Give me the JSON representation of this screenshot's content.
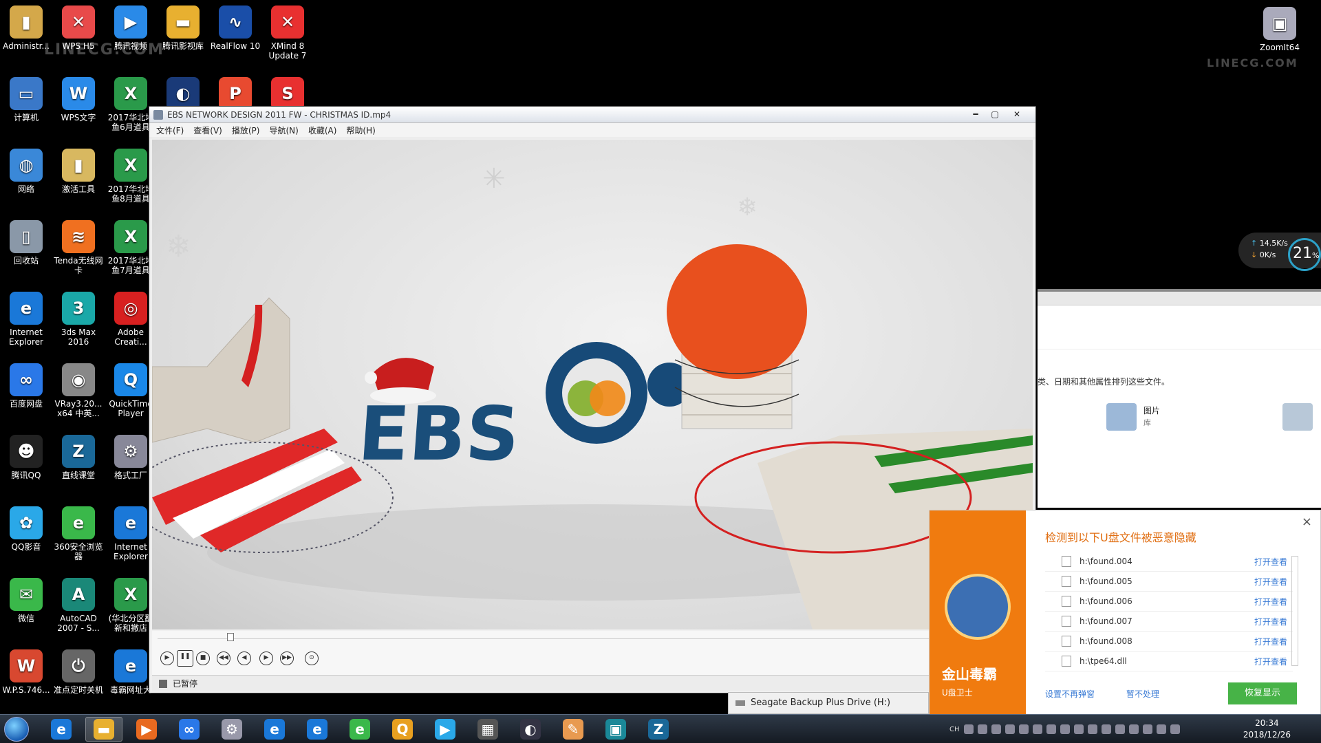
{
  "desktop": {
    "icons": [
      {
        "label": "Administr...",
        "col": 0,
        "row": 0,
        "color": "#d4a84a",
        "glyph": "▮"
      },
      {
        "label": "WPS H5",
        "col": 1,
        "row": 0,
        "color": "#e84a4a",
        "glyph": "✕"
      },
      {
        "label": "腾讯视频",
        "col": 2,
        "row": 0,
        "color": "#2a8ae8",
        "glyph": "▶"
      },
      {
        "label": "腾讯影视库",
        "col": 3,
        "row": 0,
        "color": "#e8b030",
        "glyph": "▬"
      },
      {
        "label": "RealFlow 10",
        "col": 4,
        "row": 0,
        "color": "#1a4ea8",
        "glyph": "∿"
      },
      {
        "label": "XMind 8 Update 7",
        "col": 5,
        "row": 0,
        "color": "#e83030",
        "glyph": "✕"
      },
      {
        "label": "计算机",
        "col": 0,
        "row": 1,
        "color": "#3a78c8",
        "glyph": "▭"
      },
      {
        "label": "WPS文字",
        "col": 1,
        "row": 1,
        "color": "#2a8ae8",
        "glyph": "W"
      },
      {
        "label": "2017华北地鱼6月道具",
        "col": 2,
        "row": 1,
        "color": "#2a9a4a",
        "glyph": "X"
      },
      {
        "label": "",
        "col": 3,
        "row": 1,
        "color": "#1a3a78",
        "glyph": "◐"
      },
      {
        "label": "",
        "col": 4,
        "row": 1,
        "color": "#e84a30",
        "glyph": "P"
      },
      {
        "label": "",
        "col": 5,
        "row": 1,
        "color": "#e83030",
        "glyph": "S"
      },
      {
        "label": "网络",
        "col": 0,
        "row": 2,
        "color": "#3a88d8",
        "glyph": "◍"
      },
      {
        "label": "激活工具",
        "col": 1,
        "row": 2,
        "color": "#d8b860",
        "glyph": "▮"
      },
      {
        "label": "2017华北地鱼8月道具",
        "col": 2,
        "row": 2,
        "color": "#2a9a4a",
        "glyph": "X"
      },
      {
        "label": "回收站",
        "col": 0,
        "row": 3,
        "color": "#8a98a8",
        "glyph": "▯"
      },
      {
        "label": "Tenda无线网卡",
        "col": 1,
        "row": 3,
        "color": "#f07020",
        "glyph": "≋"
      },
      {
        "label": "2017华北地鱼7月道具",
        "col": 2,
        "row": 3,
        "color": "#2a9a4a",
        "glyph": "X"
      },
      {
        "label": "Internet Explorer",
        "col": 0,
        "row": 4,
        "color": "#1a78d8",
        "glyph": "e"
      },
      {
        "label": "3ds Max 2016",
        "col": 1,
        "row": 4,
        "color": "#1aa8a8",
        "glyph": "3"
      },
      {
        "label": "Adobe Creati...",
        "col": 2,
        "row": 4,
        "color": "#d82020",
        "glyph": "◎"
      },
      {
        "label": "百度网盘",
        "col": 0,
        "row": 5,
        "color": "#2a78e8",
        "glyph": "∞"
      },
      {
        "label": "VRay3.20... x64 中英...",
        "col": 1,
        "row": 5,
        "color": "#888",
        "glyph": "◉"
      },
      {
        "label": "QuickTime Player",
        "col": 2,
        "row": 5,
        "color": "#1a88e8",
        "glyph": "Q"
      },
      {
        "label": "腾讯QQ",
        "col": 0,
        "row": 6,
        "color": "#222",
        "glyph": "☻"
      },
      {
        "label": "直线课堂",
        "col": 1,
        "row": 6,
        "color": "#1a6898",
        "glyph": "Z"
      },
      {
        "label": "格式工厂",
        "col": 2,
        "row": 6,
        "color": "#889",
        "glyph": "⚙"
      },
      {
        "label": "QQ影音",
        "col": 0,
        "row": 7,
        "color": "#2aa8e8",
        "glyph": "✿"
      },
      {
        "label": "360安全浏览器",
        "col": 1,
        "row": 7,
        "color": "#3ab84a",
        "glyph": "e"
      },
      {
        "label": "Internet Explorer",
        "col": 2,
        "row": 7,
        "color": "#1a78d8",
        "glyph": "e"
      },
      {
        "label": "微信",
        "col": 0,
        "row": 8,
        "color": "#3ab84a",
        "glyph": "✉"
      },
      {
        "label": "AutoCAD 2007 - S...",
        "col": 1,
        "row": 8,
        "color": "#1a8878",
        "glyph": "A"
      },
      {
        "label": "(华北分区翻新和撤店",
        "col": 2,
        "row": 8,
        "color": "#2a9a4a",
        "glyph": "X"
      },
      {
        "label": "W.P.S.746...",
        "col": 0,
        "row": 9,
        "color": "#d84830",
        "glyph": "W"
      },
      {
        "label": "准点定时关机",
        "col": 1,
        "row": 9,
        "color": "#666",
        "glyph": "⏻"
      },
      {
        "label": "毒霸网址大",
        "col": 2,
        "row": 9,
        "color": "#1a78d8",
        "glyph": "e"
      }
    ],
    "right_icon": {
      "label": "ZoomIt64",
      "color": "#aab",
      "glyph": "▣"
    },
    "watermark_left": "LINECG.COM",
    "watermark_right": "LINECG.COM"
  },
  "player": {
    "title": "EBS NETWORK DESIGN 2011 FW - CHRISTMAS ID.mp4",
    "menu": [
      "文件(F)",
      "查看(V)",
      "播放(P)",
      "导航(N)",
      "收藏(A)",
      "帮助(H)"
    ],
    "video": {
      "logo_text": "EBS"
    },
    "controls": [
      "▶",
      "❚❚",
      "■",
      "◀◀",
      "◀",
      "▶",
      "▶▶",
      "⊙"
    ],
    "progress": 0.08,
    "status": "已暂停"
  },
  "explorer": {
    "desc": "类、日期和其他属性排列这些文件。",
    "lib_label": "图片",
    "lib_sub": "库"
  },
  "net_widget": {
    "up": "14.5K/s",
    "down": "0K/s",
    "percent": "21",
    "percent_unit": "%"
  },
  "popup": {
    "title": "检测到以下U盘文件被恶意隐藏",
    "close": "×",
    "brand": "金山毒霸",
    "sub": "U盘卫士",
    "files": [
      {
        "name": "h:\\found.004",
        "action": "打开查看"
      },
      {
        "name": "h:\\found.005",
        "action": "打开查看"
      },
      {
        "name": "h:\\found.006",
        "action": "打开查看"
      },
      {
        "name": "h:\\found.007",
        "action": "打开查看"
      },
      {
        "name": "h:\\found.008",
        "action": "打开查看"
      },
      {
        "name": "h:\\tpe64.dll",
        "action": "打开查看"
      }
    ],
    "no_remind": "设置不再弹窗",
    "ignore": "暂不处理",
    "restore": "恢复显示"
  },
  "drive_notice": "Seagate Backup Plus Drive (H:)",
  "taskbar": {
    "apps": [
      {
        "name": "ie",
        "glyph": "e",
        "color": "#1a78d8"
      },
      {
        "name": "explorer",
        "glyph": "▬",
        "color": "#e8b030",
        "active": true
      },
      {
        "name": "media",
        "glyph": "▶",
        "color": "#e86a20"
      },
      {
        "name": "baidu-netdisk",
        "glyph": "∞",
        "color": "#2a78e8"
      },
      {
        "name": "format-factory",
        "glyph": "⚙",
        "color": "#99a"
      },
      {
        "name": "ie2",
        "glyph": "e",
        "color": "#1a78d8"
      },
      {
        "name": "ie3",
        "glyph": "e",
        "color": "#1a78d8"
      },
      {
        "name": "360",
        "glyph": "e",
        "color": "#3ab84a"
      },
      {
        "name": "qq-player",
        "glyph": "Q",
        "color": "#e8a020"
      },
      {
        "name": "tencent-video",
        "glyph": "▶",
        "color": "#2aa8e8"
      },
      {
        "name": "clapper",
        "glyph": "▦",
        "color": "#555"
      },
      {
        "name": "c4d",
        "glyph": "◐",
        "color": "#334"
      },
      {
        "name": "notes",
        "glyph": "✎",
        "color": "#e89a50"
      },
      {
        "name": "linecg",
        "glyph": "▣",
        "color": "#1a8898"
      },
      {
        "name": "zhixian",
        "glyph": "Z",
        "color": "#1a6898"
      }
    ],
    "tray_lang": "CH",
    "time": "20:34",
    "date": "2018/12/26"
  }
}
